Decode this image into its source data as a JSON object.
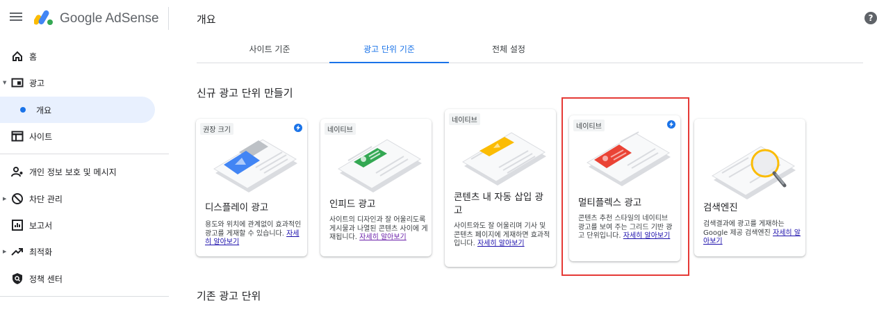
{
  "header": {
    "brand": "Google AdSense",
    "page_title": "개요",
    "help_glyph": "?"
  },
  "sidebar": {
    "items": [
      {
        "label": "홈",
        "icon": "home-icon"
      },
      {
        "label": "광고",
        "icon": "ads-icon"
      },
      {
        "label": "개요",
        "icon": "dot"
      },
      {
        "label": "사이트",
        "icon": "sites-icon"
      },
      {
        "label": "개인 정보 보호 및 메시지",
        "icon": "privacy-icon"
      },
      {
        "label": "차단 관리",
        "icon": "block-icon"
      },
      {
        "label": "보고서",
        "icon": "reports-icon"
      },
      {
        "label": "최적화",
        "icon": "optimize-icon"
      },
      {
        "label": "정책 센터",
        "icon": "policy-icon"
      }
    ]
  },
  "tabs": [
    "사이트 기준",
    "광고 단위 기준",
    "전체 설정"
  ],
  "active_tab": "광고 단위 기준",
  "sections": {
    "new_units": "신규 광고 단위 만들기",
    "existing_units": "기존 광고 단위"
  },
  "cards": [
    {
      "badge": "권장 크기",
      "title": "디스플레이 광고",
      "desc": "용도와 위치에 관계없이 효과적인 광고를 게재할 수 있습니다.",
      "link": "자세히 알아보기",
      "accent": "#4285f4"
    },
    {
      "badge": "네이티브",
      "title": "인피드 광고",
      "desc": "사이트의 디자인과 잘 어울리도록 게시물과 나열된 콘텐츠 사이에 게재됩니다.",
      "link": "자세히 알아보기",
      "accent": "#34a853"
    },
    {
      "badge": "네이티브",
      "title": "콘텐츠 내 자동 삽입 광고",
      "desc": "사이트와도 잘 어울리며 기사 및 콘텐츠 페이지에 게재하면 효과적입니다.",
      "link": "자세히 알아보기",
      "accent": "#fbbc04"
    },
    {
      "badge": "네이티브",
      "title": "멀티플렉스 광고",
      "desc": "콘텐츠 추천 스타일의 네이티브 광고를 보여 주는 그리드 기반 광고 단위입니다.",
      "link": "자세히 알아보기",
      "accent": "#ea4335"
    },
    {
      "badge": "",
      "title": "검색엔진",
      "desc": "검색결과에 광고를 게재하는 Google 제공 검색엔진",
      "link": "자세히 알아보기",
      "accent": "#fbbc04"
    }
  ]
}
